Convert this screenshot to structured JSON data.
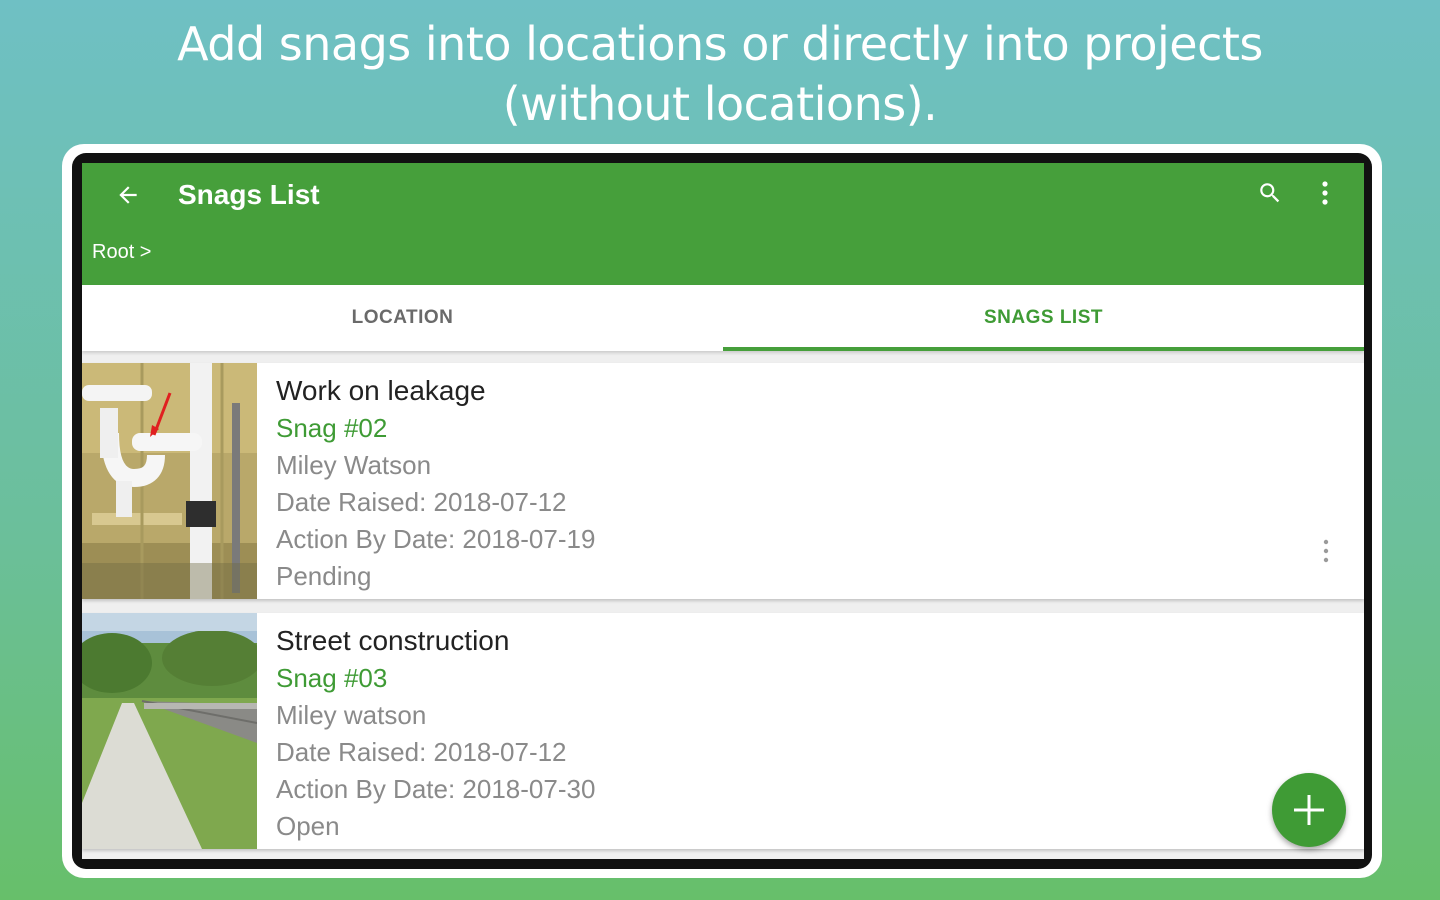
{
  "headline": {
    "line1": "Add snags into locations or directly into projects",
    "line2": "(without locations)."
  },
  "appbar": {
    "title": "Snags List",
    "breadcrumb": "Root >",
    "icons": [
      "back-arrow-icon",
      "search-icon",
      "more-vert-icon"
    ]
  },
  "tabs": [
    {
      "label": "LOCATION",
      "selected": false
    },
    {
      "label": "SNAGS LIST",
      "selected": true
    }
  ],
  "snags": [
    {
      "title": "Work on leakage",
      "number": "Snag #02",
      "assignee": "Miley Watson",
      "date_raised": "Date Raised: 2018-07-12",
      "action_by": "Action By Date: 2018-07-19",
      "status": "Pending"
    },
    {
      "title": "Street construction",
      "number": "Snag #03",
      "assignee": "Miley watson",
      "date_raised": "Date Raised: 2018-07-12",
      "action_by": "Action By Date: 2018-07-30",
      "status": "Open"
    }
  ],
  "fab": {
    "icon": "plus-icon"
  },
  "colors": {
    "primary": "#469f3b",
    "accent_text": "#3f9b35",
    "background_top": "#6fc0c4",
    "background_bottom": "#67bf6a"
  }
}
